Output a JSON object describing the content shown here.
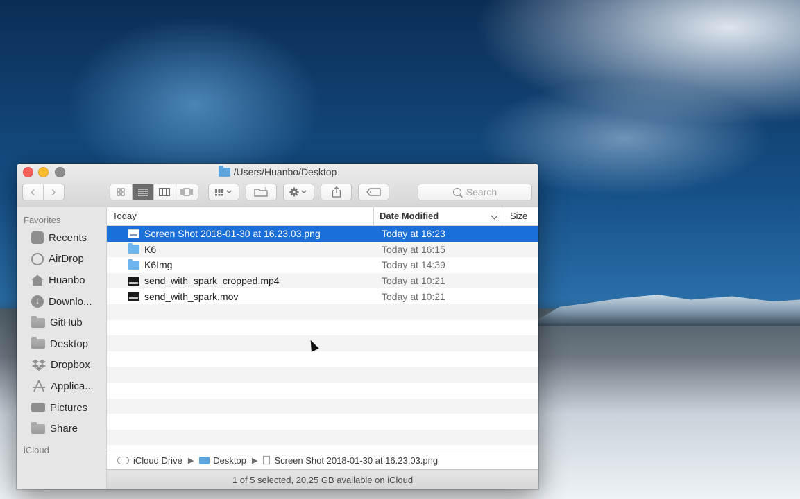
{
  "window": {
    "title": "/Users/Huanbo/Desktop"
  },
  "toolbar": {
    "back": "‹",
    "forward": "›",
    "search_placeholder": "Search"
  },
  "sidebar": {
    "favorites_heading": "Favorites",
    "icloud_heading": "iCloud",
    "items": [
      {
        "label": "Recents",
        "icon": "recents-icon"
      },
      {
        "label": "AirDrop",
        "icon": "airdrop-icon"
      },
      {
        "label": "Huanbo",
        "icon": "home-icon"
      },
      {
        "label": "Downlo...",
        "icon": "downloads-icon"
      },
      {
        "label": "GitHub",
        "icon": "folder-icon"
      },
      {
        "label": "Desktop",
        "icon": "desktop-icon"
      },
      {
        "label": "Dropbox",
        "icon": "dropbox-icon"
      },
      {
        "label": "Applica...",
        "icon": "applications-icon"
      },
      {
        "label": "Pictures",
        "icon": "pictures-icon"
      },
      {
        "label": "Share",
        "icon": "folder-icon"
      }
    ]
  },
  "columns": {
    "name": "Today",
    "date": "Date Modified",
    "size": "Size"
  },
  "files": [
    {
      "name": "Screen Shot 2018-01-30 at 16.23.03.png",
      "date": "Today at 16:23",
      "type": "png",
      "selected": true
    },
    {
      "name": "K6",
      "date": "Today at 16:15",
      "type": "folder",
      "selected": false
    },
    {
      "name": "K6Img",
      "date": "Today at 14:39",
      "type": "folder",
      "selected": false
    },
    {
      "name": "send_with_spark_cropped.mp4",
      "date": "Today at 10:21",
      "type": "video",
      "selected": false
    },
    {
      "name": "send_with_spark.mov",
      "date": "Today at 10:21",
      "type": "video",
      "selected": false
    }
  ],
  "pathbar": {
    "root": "iCloud Drive",
    "folder": "Desktop",
    "file": "Screen Shot 2018-01-30 at 16.23.03.png"
  },
  "status": {
    "text": "1 of 5 selected, 20,25 GB available on iCloud"
  },
  "colors": {
    "selection": "#1a6fd9",
    "folder": "#6db5ec"
  }
}
